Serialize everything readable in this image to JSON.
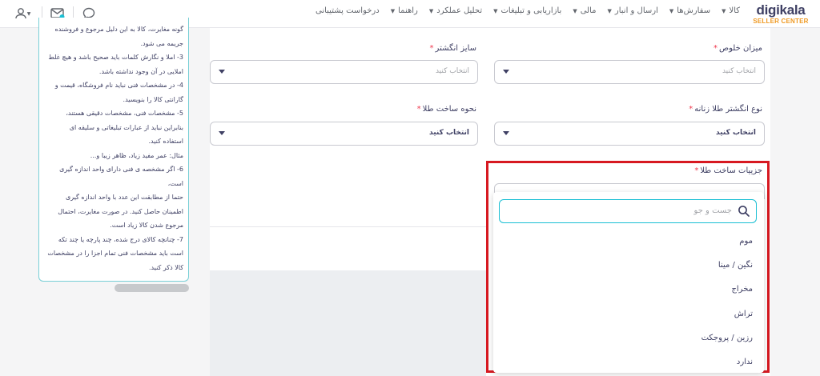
{
  "logo": {
    "brand": "digikala",
    "subtitle": "SELLER CENTER"
  },
  "nav": {
    "items": [
      {
        "label": "کالا"
      },
      {
        "label": "سفارش‌ها"
      },
      {
        "label": "ارسال و انبار"
      },
      {
        "label": "مالی"
      },
      {
        "label": "بازاریابی و تبلیغات"
      },
      {
        "label": "تحلیل عملکرد"
      },
      {
        "label": "راهنما"
      },
      {
        "label": "درخواست پشتیبانی"
      }
    ]
  },
  "toolbar": {
    "icons": [
      "user-icon",
      "mail-icon",
      "chat-icon"
    ]
  },
  "form": {
    "purity": {
      "label": "میزان خلوص",
      "placeholder": "انتخاب کنید"
    },
    "ring_size": {
      "label": "سایز انگشتر",
      "placeholder": "انتخاب کنید"
    },
    "ring_type": {
      "label": "نوع انگشتر طلا زنانه",
      "value": "انتخاب کنید"
    },
    "craft_method": {
      "label": "نحوه ساخت طلا",
      "value": "انتخاب کنید"
    },
    "craft_details": {
      "label": "جزییات ساخت طلا"
    },
    "required_mark": "*"
  },
  "dropdown": {
    "search_placeholder": "جست و جو",
    "options": [
      "موم",
      "نگین / مینا",
      "مخراج",
      "تراش",
      "رزین / پروجکت",
      "ندارد"
    ]
  },
  "guide": {
    "lines": [
      "گونه مغایرت، کالا به این دلیل مرجوع و فروشنده",
      "جریمه می شود.",
      "3- املا و نگارش کلمات باید صحیح باشد و هیچ غلط",
      "املایی در آن وجود نداشته باشد.",
      "4- در مشخصات فنی نباید نام فروشگاه، قیمت و",
      "گارانتی کالا را بنویسید.",
      "5- مشخصات فنی، مشخصات دقیقی هستند،",
      "بنابراین نباید از عبارات تبلیغاتی و سلیقه ای",
      "استفاده کنید.",
      "مثال: عمر مفید زیاد، ظاهر زیبا و...",
      "6- اگر مشخصه ی فنی دارای واحد اندازه گیری است،",
      "حتما از مطابقت این عدد با واحد اندازه گیری",
      "اطمینان حاصل کنید. در صورت مغایرت، احتمال",
      "مرجوع شدن کالا زیاد است.",
      "7- چنانچه کالای درج شده، چند پارچه یا چند تکه",
      "است باید مشخصات فنی تمام اجزا را در مشخصات",
      "کالا ذکر کنید."
    ]
  },
  "colors": {
    "accent": "#19bfd3",
    "required": "#ef394e",
    "highlight": "#d71921",
    "brand_orange": "#ef9a24"
  }
}
